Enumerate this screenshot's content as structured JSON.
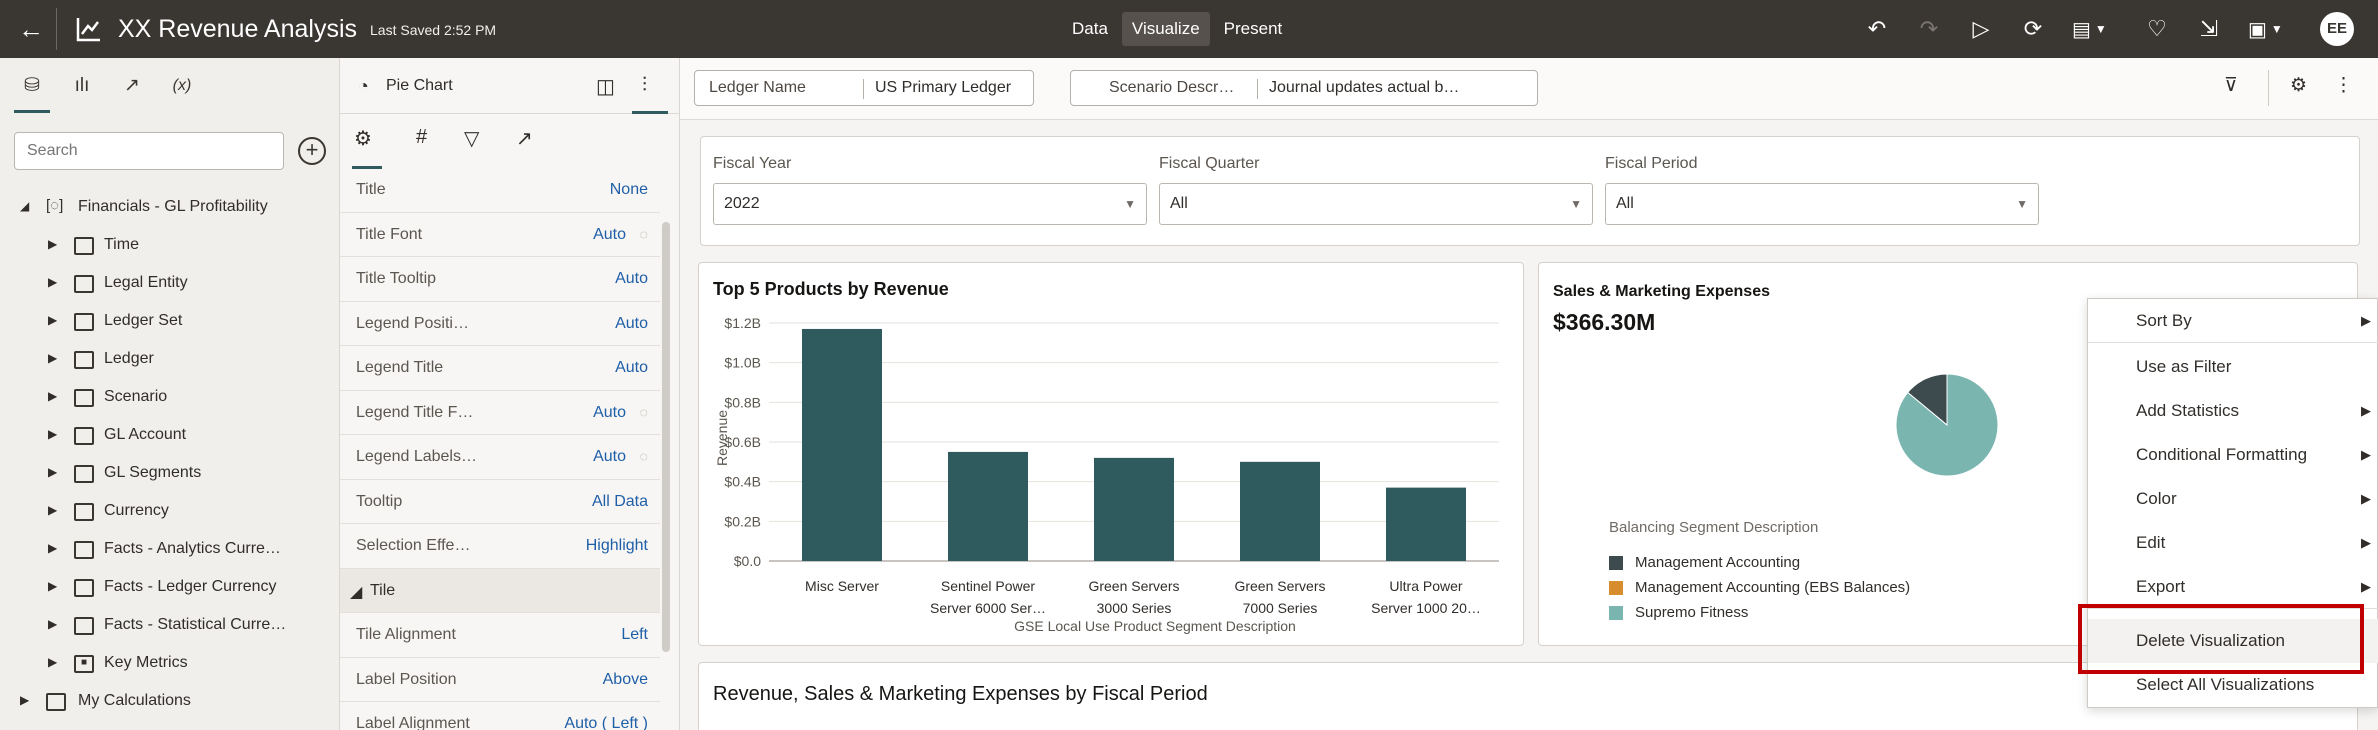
{
  "topbar": {
    "back_icon": "arrow-left-icon",
    "title": "XX Revenue Analysis",
    "saved": "Last Saved 2:52 PM",
    "modes": [
      "Data",
      "Visualize",
      "Present"
    ],
    "active_mode": "Visualize",
    "icons": [
      "undo-icon",
      "redo-icon",
      "preview-icon",
      "refresh-data-icon",
      "narrate-menu-icon",
      "insight-icon",
      "export-icon",
      "save-menu-icon"
    ],
    "avatar_initials": "EE"
  },
  "left_panel": {
    "tab_icons": [
      "database-icon",
      "chart-icon",
      "analytics-icon",
      "function-icon"
    ],
    "function_tab_label": "(x)",
    "search_placeholder": "Search",
    "tree": {
      "root": "Financials - GL Profitability",
      "folders": [
        "Time",
        "Legal Entity",
        "Ledger Set",
        "Ledger",
        "Scenario",
        "GL Account",
        "GL Segments",
        "Currency",
        "Facts - Analytics Curre…",
        "Facts - Ledger Currency",
        "Facts - Statistical Curre…"
      ],
      "key_metrics": "Key Metrics",
      "my_calculations": "My Calculations"
    }
  },
  "properties_panel": {
    "viz_type": "Pie Chart",
    "tab_icons": [
      "general-tab-icon",
      "number-format-icon",
      "filter-icon",
      "analytics-tab-icon"
    ],
    "tab_number_glyph": "#",
    "rows": [
      {
        "key": "Title",
        "value": "None"
      },
      {
        "key": "Title Font",
        "value": "Auto"
      },
      {
        "key": "Title Tooltip",
        "value": "Auto"
      },
      {
        "key": "Legend Positi…",
        "value": "Auto"
      },
      {
        "key": "Legend Title",
        "value": "Auto"
      },
      {
        "key": "Legend Title F…",
        "value": "Auto"
      },
      {
        "key": "Legend Labels…",
        "value": "Auto"
      },
      {
        "key": "Tooltip",
        "value": "All Data"
      },
      {
        "key": "Selection Effe…",
        "value": "Highlight"
      }
    ],
    "section": "Tile",
    "tile_rows": [
      {
        "key": "Tile Alignment",
        "value": "Left"
      },
      {
        "key": "Label Position",
        "value": "Above"
      },
      {
        "key": "Label Alignment",
        "value": "Auto ( Left )"
      }
    ]
  },
  "filter_bar": {
    "filters": [
      {
        "name": "Ledger Name",
        "value": "US Primary Ledger"
      },
      {
        "name": "Scenario Descr…",
        "value": "Journal updates actual b…"
      }
    ]
  },
  "dashboard_filters": [
    {
      "label": "Fiscal Year",
      "value": "2022"
    },
    {
      "label": "Fiscal Quarter",
      "value": "All"
    },
    {
      "label": "Fiscal Period",
      "value": "All"
    }
  ],
  "bar_viz": {
    "title": "Top 5 Products by Revenue",
    "ylabel": "Revenue",
    "xlabel": "GSE Local Use Product Segment Description",
    "yticks": [
      "$0.0",
      "$0.2B",
      "$0.4B",
      "$0.6B",
      "$0.8B",
      "$1.0B",
      "$1.2B"
    ],
    "category_lines": [
      [
        "Misc Server"
      ],
      [
        "Sentinel Power",
        "Server 6000 Ser…"
      ],
      [
        "Green Servers",
        "3000 Series"
      ],
      [
        "Green Servers",
        "7000 Series"
      ],
      [
        "Ultra Power",
        "Server 1000 20…"
      ]
    ]
  },
  "pie_viz": {
    "title": "Sales & Marketing Expenses",
    "metric": "$366.30M",
    "legend_title": "Balancing Segment Description"
  },
  "chart_data": [
    {
      "type": "bar",
      "categories": [
        "Misc Server",
        "Sentinel Power Server 6000 Ser…",
        "Green Servers 3000 Series",
        "Green Servers 7000 Series",
        "Ultra Power Server 1000 20…"
      ],
      "values": [
        1.17,
        0.55,
        0.52,
        0.5,
        0.37
      ],
      "title": "Top 5 Products by Revenue",
      "xlabel": "GSE Local Use Product Segment Description",
      "ylabel": "Revenue",
      "ylim": [
        0,
        1.2
      ],
      "grid": true,
      "color": "#2f5b5f"
    },
    {
      "type": "pie",
      "title": "Sales & Marketing Expenses",
      "series": [
        {
          "name": "Management Accounting",
          "value": 0.14,
          "color": "#3d4b4f"
        },
        {
          "name": "Management Accounting (EBS Balances)",
          "value": 0.0,
          "color": "#d78c2e"
        },
        {
          "name": "Supremo Fitness",
          "value": 0.86,
          "color": "#7ab5b0"
        }
      ]
    }
  ],
  "bottom_viz": {
    "title": "Revenue, Sales & Marketing Expenses by Fiscal Period"
  },
  "context_menu": {
    "items": [
      {
        "label": "Sort By",
        "submenu": true
      },
      {
        "label": "Use as Filter",
        "submenu": false
      },
      {
        "label": "Add Statistics",
        "submenu": true
      },
      {
        "label": "Conditional Formatting",
        "submenu": true
      },
      {
        "label": "Color",
        "submenu": true
      },
      {
        "label": "Edit",
        "submenu": true
      },
      {
        "label": "Export",
        "submenu": true
      },
      {
        "label": "Delete Visualization",
        "submenu": false
      },
      {
        "label": "Select All Visualizations",
        "submenu": false
      }
    ],
    "highlighted": "Delete Visualization",
    "highlight_color": "#c00000"
  }
}
